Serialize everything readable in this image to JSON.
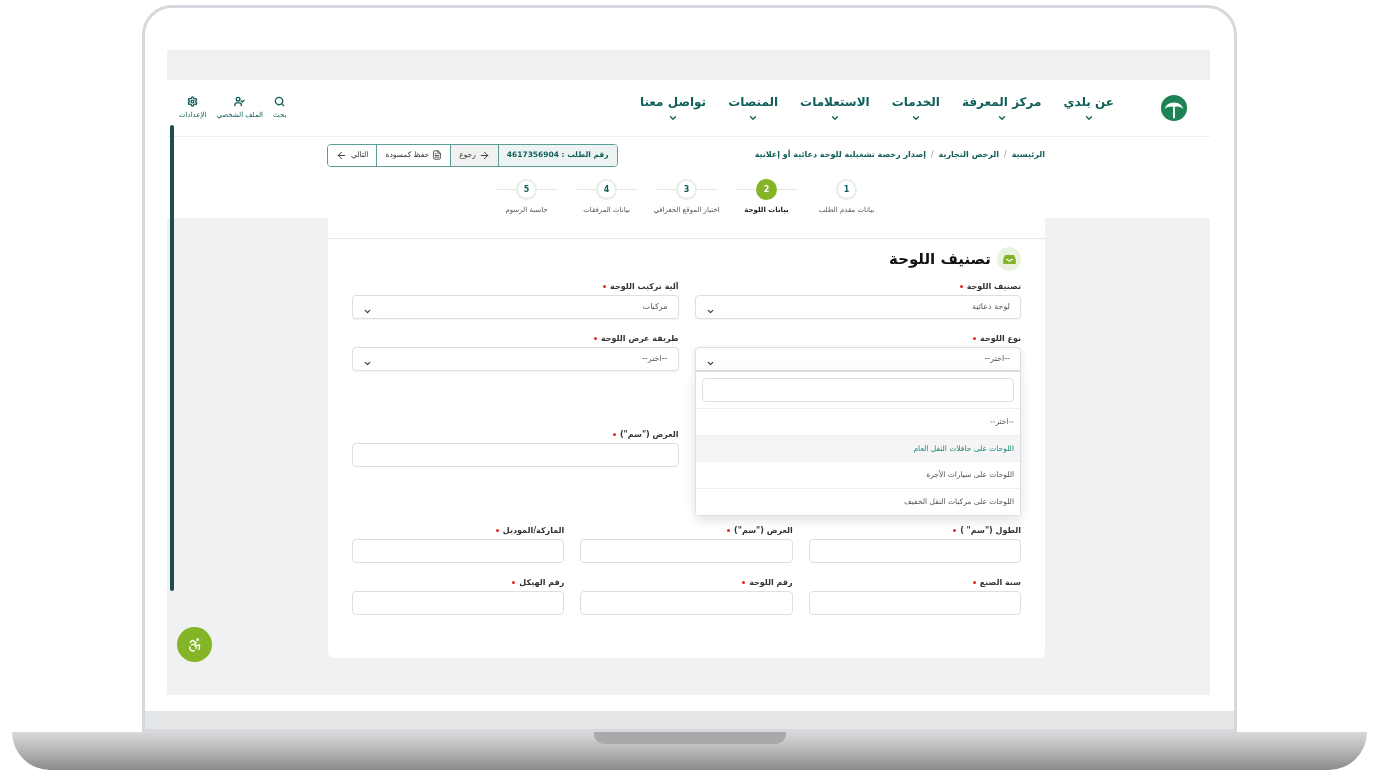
{
  "nav": {
    "items": [
      {
        "label": "عن بلدي"
      },
      {
        "label": "مركز المعرفة"
      },
      {
        "label": "الخدمات"
      },
      {
        "label": "الاستعلامات"
      },
      {
        "label": "المنصات"
      },
      {
        "label": "تواصل معنا"
      }
    ],
    "tools": [
      {
        "kind": "search",
        "label": "بحث"
      },
      {
        "kind": "profile",
        "label": "الملف الشخصي"
      },
      {
        "kind": "settings",
        "label": "الإعدادات"
      }
    ]
  },
  "breadcrumb_separator": "/",
  "breadcrumbs": [
    "الرئيسية",
    "الرخص التجارية",
    "إصدار رخصة تشغيلية للوحة دعائية أو إعلانية"
  ],
  "actions": {
    "request_number": "رقم الطلب : 4617356904",
    "back": "رجوع",
    "draft": "حفظ كمسودة",
    "next": "التالي"
  },
  "steps": [
    {
      "number": "1",
      "label": "بيانات مقدم الطلب",
      "selected": false
    },
    {
      "number": "2",
      "label": "بيانات اللوحة",
      "selected": true
    },
    {
      "number": "3",
      "label": "اختيار الموقع الجغرافي",
      "selected": false
    },
    {
      "number": "4",
      "label": "بيانات المرفقات",
      "selected": false
    },
    {
      "number": "5",
      "label": "حاسبة الرسوم",
      "selected": false
    }
  ],
  "section_title": "تصنيف اللوحة",
  "rows": [
    [
      {
        "kind": "select",
        "label": "تصنيف اللوحة",
        "required": true,
        "value": "لوحة دعائية"
      },
      {
        "kind": "select",
        "label": "آلية تركيب اللوحة",
        "required": true,
        "value": "مركبات"
      }
    ],
    [
      {
        "kind": "select",
        "label": "نوع اللوحة",
        "required": true,
        "value": "--اختر--",
        "open": true,
        "options": [
          {
            "label": "--اختر--",
            "highlighted": false
          },
          {
            "label": "اللوحات على حافلات النقل العام",
            "highlighted": true
          },
          {
            "label": "اللوحات على سيارات الأجرة",
            "highlighted": false
          },
          {
            "label": "اللوحات على مركبات النقل الخفيف",
            "highlighted": false
          }
        ]
      },
      {
        "kind": "select",
        "label": "طريقة عرض اللوحة",
        "required": true,
        "value": "--اختر--"
      }
    ],
    [
      {
        "kind": "text",
        "label": "العرض (\"سم\")",
        "required": true
      }
    ],
    [
      {
        "kind": "text",
        "label": "الطول (\"سم\" )",
        "required": true
      },
      {
        "kind": "text",
        "label": "العرض (\"سم\")",
        "required": true
      },
      {
        "kind": "text",
        "label": "الماركة/الموديل",
        "required": true
      }
    ],
    [
      {
        "kind": "text",
        "label": "سنة الصنع",
        "required": true
      },
      {
        "kind": "text",
        "label": "رقم اللوحة",
        "required": true
      },
      {
        "kind": "text",
        "label": "رقم الهيكل",
        "required": true
      }
    ]
  ]
}
